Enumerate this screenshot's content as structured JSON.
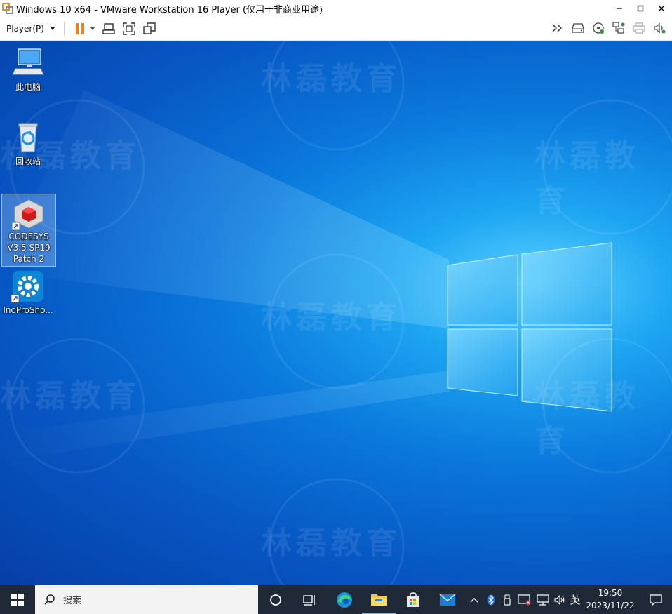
{
  "window": {
    "title": "Windows 10 x64 - VMware Workstation 16 Player (仅用于非商业用途)",
    "icon": "vmware-icon",
    "controls": [
      "minimize-icon",
      "maximize-icon",
      "close-icon"
    ]
  },
  "toolbar": {
    "player_menu": "Player(P)",
    "left_icons": [
      "pause-icon",
      "dropdown-arrow-icon",
      "send-ctrl-alt-del-icon",
      "fullscreen-icon",
      "unity-icon"
    ],
    "right_icons": [
      "more-icon",
      "hard-disk-icon",
      "cd-icon",
      "network-adapter-icon",
      "printer-icon",
      "sound-icon"
    ]
  },
  "desktop": {
    "icons": [
      {
        "label": "此电脑",
        "icon": "computer-icon",
        "selected": false
      },
      {
        "label": "回收站",
        "icon": "recycle-bin-icon",
        "selected": false
      },
      {
        "label": "CODESYS V3.5 SP19 Patch 2",
        "icon": "codesys-icon",
        "selected": true
      },
      {
        "label": "InoProSho...",
        "icon": "inoproshop-icon",
        "selected": false
      }
    ],
    "watermark_text": "林磊教育"
  },
  "taskbar": {
    "search_placeholder": "搜索",
    "apps": [
      "cortana-icon",
      "task-view-icon",
      "edge-icon",
      "file-explorer-icon",
      "store-icon",
      "mail-icon"
    ],
    "tray_icons": [
      "show-hidden-icon",
      "bluetooth-icon",
      "usb-icon",
      "security-icon",
      "network-icon",
      "volume-icon"
    ],
    "ime": "英",
    "time": "19:50",
    "date": "2023/11/22",
    "notification_icon": "notification-icon"
  },
  "colors": {
    "desktop_blue": "#0a78dc",
    "taskbar_bg": "#1f2937",
    "pause_orange": "#f07d1e"
  }
}
